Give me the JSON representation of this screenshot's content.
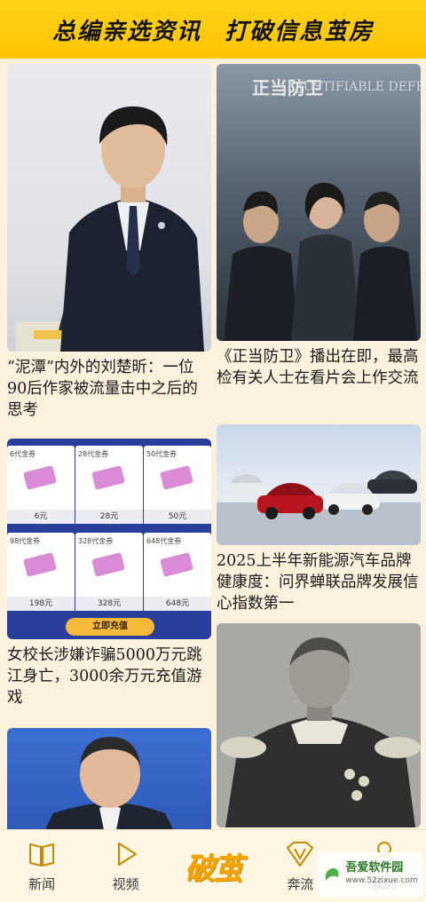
{
  "banner": {
    "left": "总编亲选资讯",
    "right": "打破信息茧房"
  },
  "feed": {
    "cards": [
      {
        "title": "“泥潭”内外的刘楚昕：一位90后作家被流量击中之后的思考"
      },
      {
        "title": "《正当防卫》播出在即，最高检有关人士在看片会上作交流",
        "poster_cn": "正当防卫",
        "poster_en": "JUSTIFIABLE DEFENSE"
      },
      {
        "title": "女校长涉嫌诈骗5000万元跳江身亡，3000余万元充值游戏",
        "recharge_button": "立即充值",
        "tiles": [
          {
            "top": "6代金券",
            "price": "6元"
          },
          {
            "top": "28代金券",
            "price": "28元"
          },
          {
            "top": "50代金券",
            "price": "50元"
          },
          {
            "top": "98代金券",
            "price": "198元"
          },
          {
            "top": "328代金券",
            "price": "328元"
          },
          {
            "top": "648代金券",
            "price": "648元"
          }
        ]
      },
      {
        "title": "2025上半年新能源汽车品牌健康度：问界蝉联品牌发展信心指数第一"
      },
      {
        "title": ""
      },
      {
        "title": ""
      }
    ]
  },
  "nav": {
    "items": [
      {
        "label": "新闻",
        "icon": "book-icon"
      },
      {
        "label": "视频",
        "icon": "play-icon"
      },
      {
        "label": "破茧",
        "icon": "pojian-logo"
      },
      {
        "label": "奔流",
        "icon": "v-gem-icon"
      },
      {
        "label": "我的",
        "icon": "person-icon"
      }
    ]
  },
  "watermark": {
    "name": "吾爱软件园",
    "url": "www.52zixue.com"
  },
  "colors": {
    "banner": "#ffc400",
    "background": "#fbf1dc",
    "brand": "#f2a500"
  }
}
